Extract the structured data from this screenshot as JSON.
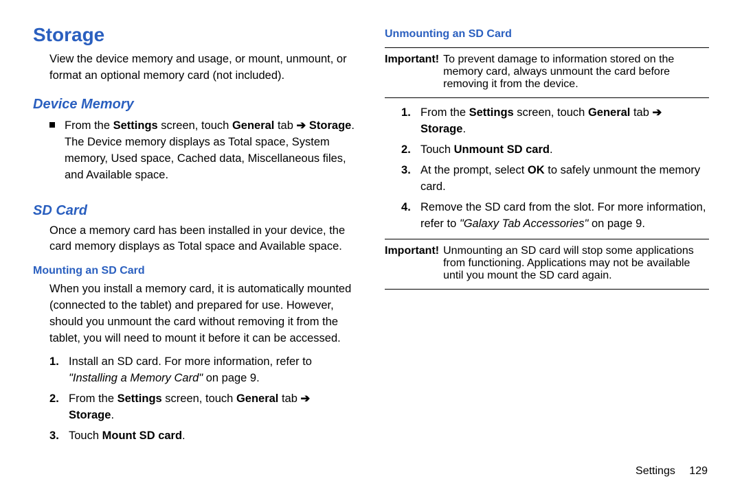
{
  "left": {
    "h1": "Storage",
    "intro": "View the device memory and usage, or mount, unmount, or format an optional memory card (not included).",
    "device_memory": {
      "title": "Device Memory",
      "bullet_pre": "From the ",
      "bullet_b1": "Settings",
      "bullet_mid1": " screen, touch ",
      "bullet_b2": "General",
      "bullet_mid2": " tab ",
      "arrow": "➔",
      "bullet_b3": "Storage",
      "bullet_rest": ". The Device memory displays as Total space, System memory, Used space, Cached data, Miscellaneous files, and Available space."
    },
    "sdcard": {
      "title": "SD Card",
      "intro": "Once a memory card has been installed in your device, the card memory displays as Total space and Available space."
    },
    "mounting": {
      "title": "Mounting an SD Card",
      "intro": "When you install a memory card, it is automatically mounted (connected to the tablet) and prepared for use. However, should you unmount the card without removing it from the tablet, you will need to mount it before it can be accessed.",
      "steps": {
        "s1_a": "Install an SD card. For more information, refer to ",
        "s1_ref": "\"Installing a Memory Card\"",
        "s1_b": " on page 9.",
        "s2_a": "From the ",
        "s2_b1": "Settings",
        "s2_m1": " screen, touch ",
        "s2_b2": "General",
        "s2_m2": " tab ",
        "arrow": "➔",
        "s2_b3": "Storage",
        "s2_end": ".",
        "s3_a": "Touch ",
        "s3_b": "Mount SD card",
        "s3_end": "."
      }
    }
  },
  "right": {
    "unmount": {
      "title": "Unmounting an SD Card",
      "imp1_label": "Important!",
      "imp1_text": "To prevent damage to information stored on the memory card, always unmount the card before removing it from the device.",
      "steps": {
        "s1_a": "From the ",
        "s1_b1": "Settings",
        "s1_m1": " screen, touch ",
        "s1_b2": "General",
        "s1_m2": " tab ",
        "arrow": "➔",
        "s1_b3": "Storage",
        "s1_end": ".",
        "s2_a": "Touch ",
        "s2_b": "Unmount SD card",
        "s2_end": ".",
        "s3_a": "At the prompt, select ",
        "s3_b": "OK",
        "s3_rest": " to safely unmount the memory card.",
        "s4_a": "Remove the SD card from the slot. For more information, refer to ",
        "s4_ref": "\"Galaxy Tab Accessories\"",
        "s4_b": " on page 9."
      },
      "imp2_label": "Important!",
      "imp2_text": "Unmounting an SD card will stop some applications from functioning. Applications may not be available until you mount the SD card again."
    }
  },
  "footer": {
    "section": "Settings",
    "page": "129"
  }
}
